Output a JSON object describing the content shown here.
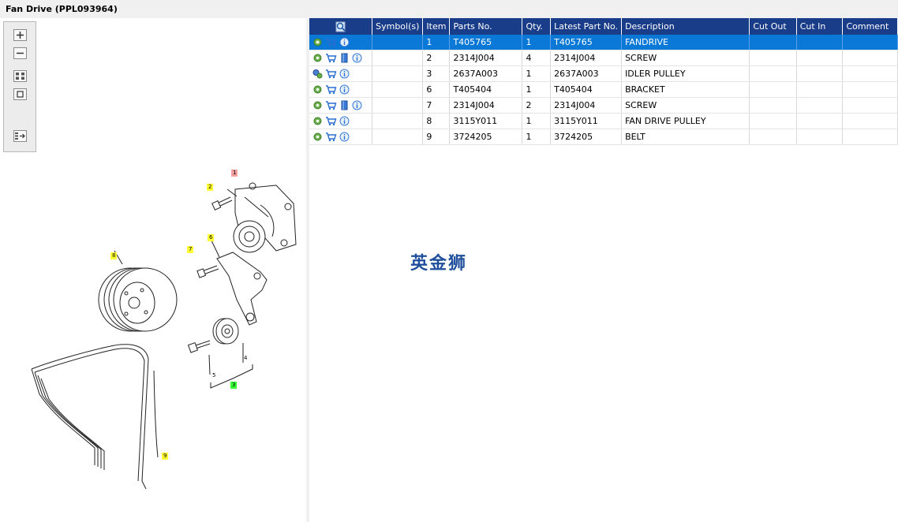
{
  "title": "Fan Drive (PPL093964)",
  "watermark": "英金狮",
  "columns": [
    "",
    "Symbol(s)",
    "Item",
    "Parts No.",
    "Qty.",
    "Latest Part No.",
    "Description",
    "Cut Out",
    "Cut In",
    "Comment"
  ],
  "rows": [
    {
      "item": "1",
      "part": "T405765",
      "qty": "1",
      "latest": "T405765",
      "desc": "FANDRIVE",
      "selected": true,
      "book": false,
      "gear": "single"
    },
    {
      "item": "2",
      "part": "2314J004",
      "qty": "4",
      "latest": "2314J004",
      "desc": "SCREW",
      "selected": false,
      "book": true,
      "gear": "single"
    },
    {
      "item": "3",
      "part": "2637A003",
      "qty": "1",
      "latest": "2637A003",
      "desc": "IDLER PULLEY",
      "selected": false,
      "book": false,
      "gear": "double"
    },
    {
      "item": "6",
      "part": "T405404",
      "qty": "1",
      "latest": "T405404",
      "desc": "BRACKET",
      "selected": false,
      "book": false,
      "gear": "single"
    },
    {
      "item": "7",
      "part": "2314J004",
      "qty": "2",
      "latest": "2314J004",
      "desc": "SCREW",
      "selected": false,
      "book": true,
      "gear": "single"
    },
    {
      "item": "8",
      "part": "3115Y011",
      "qty": "1",
      "latest": "3115Y011",
      "desc": "FAN DRIVE PULLEY",
      "selected": false,
      "book": false,
      "gear": "single"
    },
    {
      "item": "9",
      "part": "3724205",
      "qty": "1",
      "latest": "3724205",
      "desc": "BELT",
      "selected": false,
      "book": false,
      "gear": "single"
    }
  ],
  "callouts": {
    "c1": "1",
    "c2": "2",
    "c6": "6",
    "c7": "7",
    "c8": "8",
    "c9": "9",
    "c3": "3",
    "c4": "4",
    "c5": "5"
  },
  "toolbox": [
    "zoom-in",
    "zoom-out",
    "fit-all",
    "fit-window",
    "toggle-list"
  ],
  "colors": {
    "header": "#1a3d8a",
    "selected": "#0a78d7",
    "watermark": "#1f4f9c"
  }
}
